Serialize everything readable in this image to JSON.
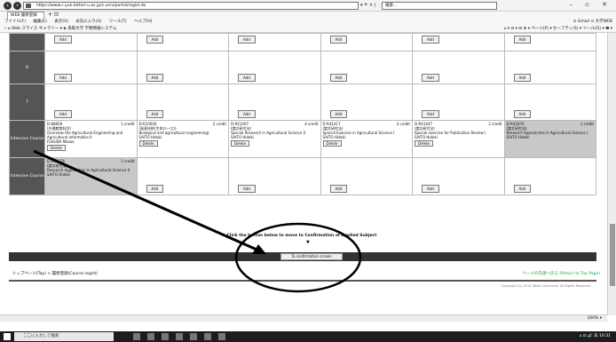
{
  "browser": {
    "url": "https://www.c.yuk.tottori-u.ac.jp/c.univ/portal/regist.do",
    "url_tools": "▾ ≙ ✕  (",
    "search_placeholder": "検索...",
    "tab_label": "WEB 履修登録",
    "new_tab": "+ ⊡",
    "menu_items": [
      "ファイル(F)",
      "編集(E)",
      "表示(V)",
      "お気に入り(A)",
      "ツール(T)",
      "ヘルプ(H)"
    ],
    "menu_right": "⊙ Gmail ⊙ 大学WEB",
    "fav_left": "☆  ▸ Web スライス ギャラリー ▾   ◈ 鳥取大学 学務情報システム",
    "fav_right": "⌂ ▾ ⊡ ▾ ⊟ ⊕ ▾ ページ(P) ▾ セーフティ(S) ▾ ツール(O) ▾ ❶ ▾",
    "window_controls": "– ▫ ✕"
  },
  "grid": {
    "add_label": "Add",
    "delete_label": "Delete",
    "row_labels": [
      "",
      "6",
      "7",
      "Intensive Course",
      "Intensive Course"
    ],
    "intensive_row_1": [
      {
        "code": "D-88000",
        "credits": "1 credit",
        "title_ja": "(共通教育科目)",
        "title_en": "Overview the Agricultural Engineering and Agricultural Informatics II",
        "teacher": "FUKUDA Masao",
        "shaded": false
      },
      {
        "code": "D-R10604",
        "credits": "2 credit",
        "title_ja": "(発表技術(生命ロース))",
        "title_en": "Biological and agricultural engineering(",
        "teacher": "SAITO Hideki",
        "shaded": false
      },
      {
        "code": "D-R41407",
        "credits": "4 credit",
        "title_ja": "(論文研究法)",
        "title_en": "Special Research in Agricultural Science (I",
        "teacher": "SAITO Hideki",
        "shaded": false
      },
      {
        "code": "D-R41417",
        "credits": "4 credit",
        "title_ja": "(論文研究法)",
        "title_en": "Special Exercise in Agricultural Science I",
        "teacher": "SAITO Hideki",
        "shaded": false
      },
      {
        "code": "D-R41447",
        "credits": "2 credit",
        "title_ja": "(論文研究法)",
        "title_en": "Special exercise for Publication Review I",
        "teacher": "SAITO Hideki",
        "shaded": false
      },
      {
        "code": "D-R41870",
        "credits": "1 credit",
        "title_ja": "(論文研究法)",
        "title_en": "Research Approaches in Agricultural Science I",
        "teacher": "SAITO Hideki",
        "shaded": true
      }
    ],
    "intensive_row_2": {
      "code": "D-R41376",
      "credits": "1 credit",
      "title_ja": "(論文研究法)",
      "title_en": "Research Approaches in Agricultural Science II",
      "teacher": "SAITO Hideki"
    }
  },
  "instruction": "Click the button below to move to Confirmation of Applied Subject",
  "arrow_mark": "▼",
  "confirm_button": "To confirmation screen",
  "breadcrumb": "トップページ(Top) > 履修登録(Course regist)",
  "top_link": "ページの先頭へ戻る (Return to Top Page)",
  "copyright": "Copyright (C) 2014 Tottori University. All Rights Reserved.",
  "zoom": "100% ▾",
  "taskbar": {
    "search_placeholder": "ここに入力して検索",
    "tray_time": "10:31",
    "tray_text": "⌂ ⊡ 🔊 あ"
  }
}
